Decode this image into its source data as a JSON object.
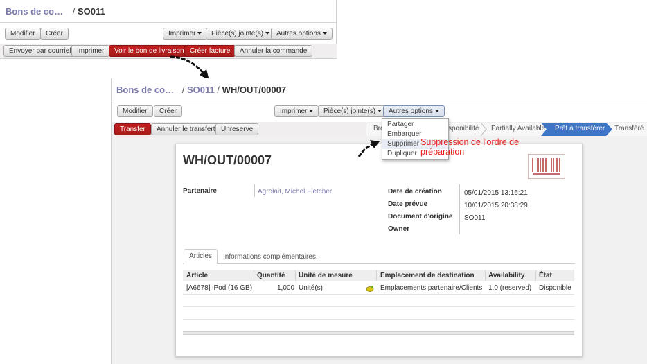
{
  "top": {
    "breadcrumb": {
      "parent": "Bons de co…",
      "sep": "/",
      "current": "SO011"
    },
    "buttons": {
      "edit": "Modifier",
      "create": "Créer"
    },
    "sidebar": {
      "print": "Imprimer",
      "attachments": "Pièce(s) jointe(s)",
      "more": "Autres options"
    },
    "actions": {
      "send": "Envoyer par courriel",
      "print": "Imprimer",
      "delivery": "Voir le bon de livraison",
      "invoice": "Créer facture",
      "cancel": "Annuler la commande"
    }
  },
  "bottom": {
    "breadcrumb": {
      "parent": "Bons de co…",
      "sep1": "/",
      "middle": "SO011",
      "sep2": "/",
      "current": "WH/OUT/00007"
    },
    "buttons": {
      "edit": "Modifier",
      "create": "Créer"
    },
    "sidebar": {
      "print": "Imprimer",
      "attachments": "Pièce(s) jointe(s)",
      "more": "Autres options"
    },
    "actions": {
      "transfer": "Transfer",
      "cancel_transfer": "Annuler le transfert",
      "unreserve": "Unreserve"
    },
    "statusbar": {
      "draft_partial": "Bro",
      "waiting_partial": "sponibilité",
      "partially_available": "Partially Available",
      "ready": "Prêt à transférer",
      "done": "Transféré"
    },
    "dropdown": {
      "items": [
        "Partager",
        "Embarquer",
        "Supprimer",
        "Dupliquer"
      ],
      "highlighted": "Supprimer"
    },
    "annotation": {
      "line1": "Suppression de l'ordre de",
      "line2": "préparation",
      "color": "#e8201c"
    },
    "form": {
      "title": "WH/OUT/00007",
      "partner_label": "Partenaire",
      "partner_value": "Agrolait, Michel Fletcher",
      "creation_label": "Date de création",
      "creation_value": "05/01/2015 13:16:21",
      "scheduled_label": "Date prévue",
      "scheduled_value": "10/01/2015 20:38:29",
      "origin_label": "Document d'origine",
      "origin_value": "SO011",
      "owner_label": "Owner",
      "tabs": [
        "Articles",
        "Informations complémentaires."
      ],
      "table": {
        "headers": [
          "Article",
          "Quantité",
          "Unité de mesure",
          "Emplacement de destination",
          "Availability",
          "État"
        ],
        "rows": [
          [
            "[A6678] iPod (16 GB)",
            "1,000",
            "Unité(s)",
            "Emplacements partenaire/Clients",
            "1.0 (reserved)",
            "Disponible"
          ]
        ]
      }
    }
  },
  "colors": {
    "primary_red": "#c0201f",
    "link": "#7c7bad",
    "ready_state": "#3e75c6"
  }
}
